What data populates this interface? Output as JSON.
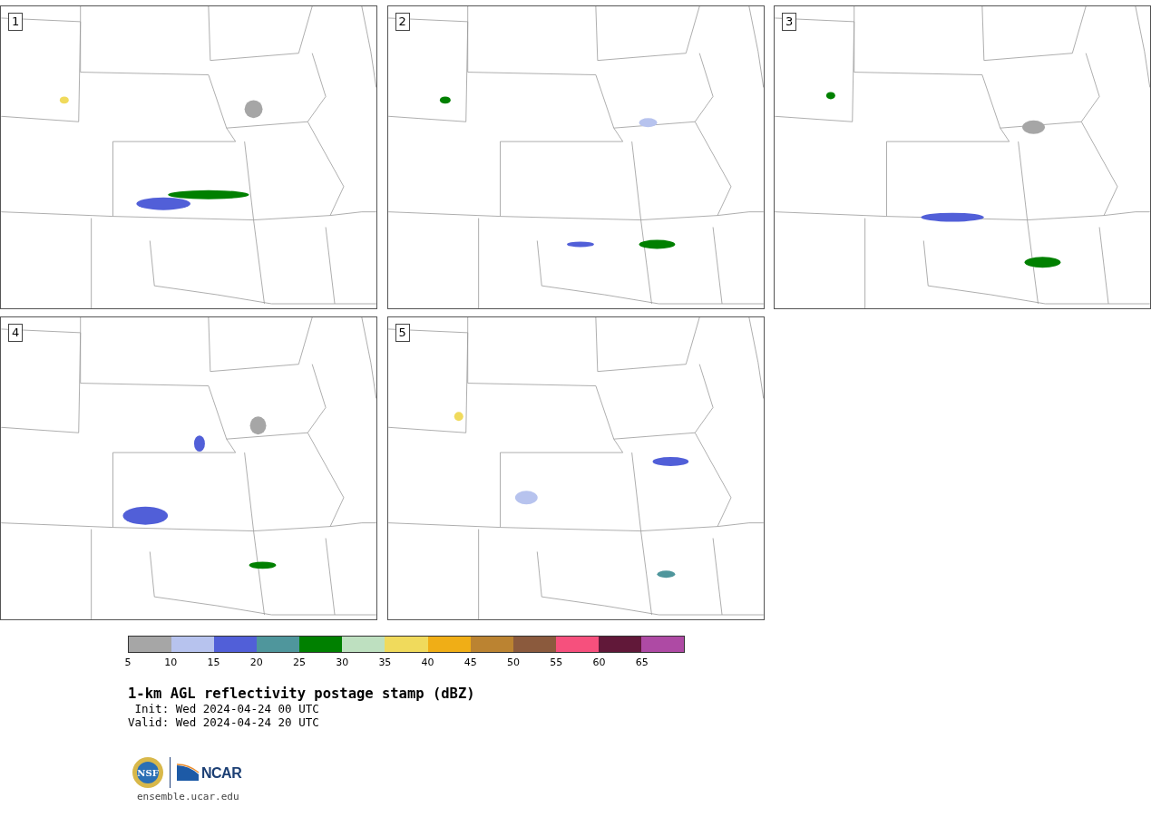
{
  "panels": [
    {
      "label": "1"
    },
    {
      "label": "2"
    },
    {
      "label": "3"
    },
    {
      "label": "4"
    },
    {
      "label": "5"
    }
  ],
  "colorbar": {
    "bins": [
      {
        "color": "#a6a6a6"
      },
      {
        "color": "#b7c3ee"
      },
      {
        "color": "#515fd8"
      },
      {
        "color": "#4f969c"
      },
      {
        "color": "#008000"
      },
      {
        "color": "#bee0c0"
      },
      {
        "color": "#f0da5c"
      },
      {
        "color": "#f0ae16"
      },
      {
        "color": "#bb8331"
      },
      {
        "color": "#8b5a3d"
      },
      {
        "color": "#f6507d"
      },
      {
        "color": "#611839"
      },
      {
        "color": "#ae4aa4"
      }
    ],
    "ticks": [
      "5",
      "10",
      "15",
      "20",
      "25",
      "30",
      "35",
      "40",
      "45",
      "50",
      "55",
      "60",
      "65"
    ]
  },
  "title": "1-km AGL reflectivity postage stamp (dBZ)",
  "init": " Init: Wed 2024-04-24 00 UTC",
  "valid": "Valid: Wed 2024-04-24 20 UTC",
  "logos": {
    "ncar": "NCAR",
    "nsf": "NSF"
  },
  "url": "ensemble.ucar.edu"
}
